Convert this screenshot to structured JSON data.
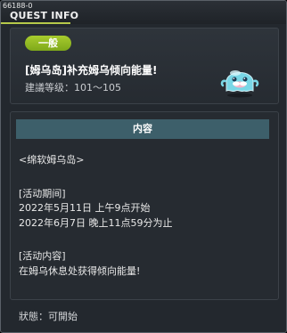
{
  "window": {
    "quest_id": "66188-0",
    "title": "QUEST INFO"
  },
  "header": {
    "category": "一般",
    "quest_name": "[姆乌岛]补充姆乌倾向能量!",
    "recommended_level": "建議等级：101～105"
  },
  "content": {
    "heading": "内容",
    "lines": [
      "<绵软姆乌岛>",
      "[活动期间]",
      "2022年5月11日 上午9点开始",
      "2022年6月7日 晚上11点59分为止",
      "[活动内容]",
      "在姆乌休息处获得倾向能量!"
    ]
  },
  "status": "狀態：可開始",
  "colors": {
    "badge_green": "#93bb24",
    "content_header_teal": "#3d5f6a",
    "title_underline": "#b6c94a"
  },
  "icons": {
    "npc": "blue-ghost-mu-icon"
  }
}
